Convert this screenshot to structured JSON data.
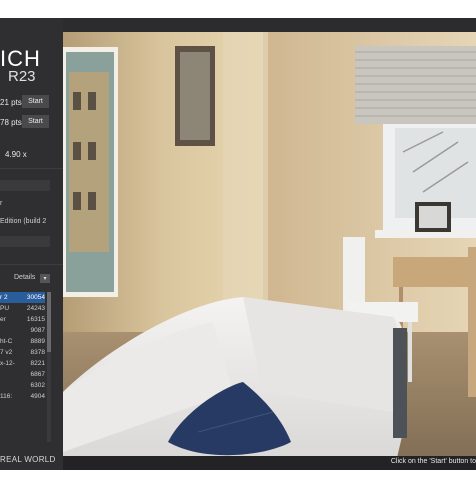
{
  "app": {
    "logo_line1": "ICH",
    "logo_line2": "R23"
  },
  "benchmarks": {
    "multi_core": {
      "score": "21 pts",
      "button": "Start"
    },
    "single_core": {
      "score": "78 pts",
      "button": "Start"
    },
    "mp_ratio": "4.90 x"
  },
  "system_info": {
    "line1": "r",
    "line2": "Edition (build 2"
  },
  "ranking": {
    "details_label": "Details",
    "rows": [
      {
        "name": "r 2",
        "score": "30054",
        "active": true
      },
      {
        "name": "PU",
        "score": "24243",
        "active": false
      },
      {
        "name": "er",
        "score": "16315",
        "active": false
      },
      {
        "name": "",
        "score": "9087",
        "active": false
      },
      {
        "name": "ht-C",
        "score": "8889",
        "active": false
      },
      {
        "name": "7 v2",
        "score": "8378",
        "active": false
      },
      {
        "name": "x-12-",
        "score": "8221",
        "active": false
      },
      {
        "name": "",
        "score": "6867",
        "active": false
      },
      {
        "name": "",
        "score": "6302",
        "active": false
      },
      {
        "name": "116:",
        "score": "4904",
        "active": false
      }
    ]
  },
  "footer": {
    "brand": "REAL WORLD",
    "status_message": "Click on the 'Start' button to"
  },
  "colors": {
    "window_bg": "#2c2c2e",
    "selection": "#2a5d9c"
  }
}
